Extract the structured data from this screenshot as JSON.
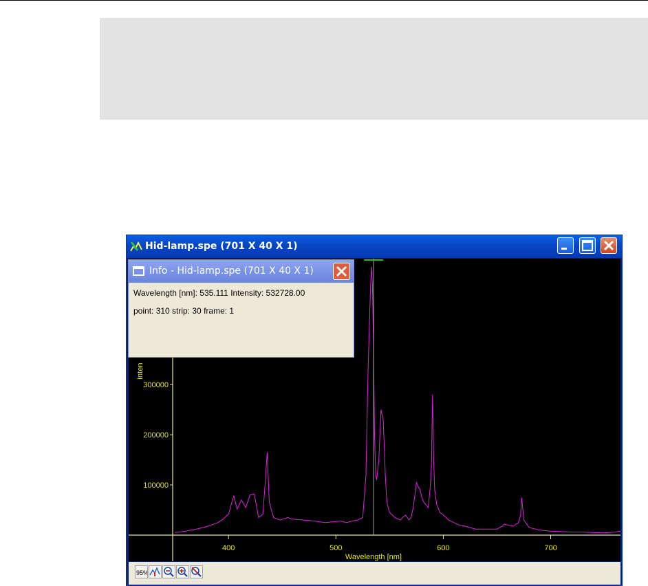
{
  "window": {
    "title": "Hid-lamp.spe (701 X 40 X 1)",
    "icons": [
      "spectrum-app-icon",
      "minimize-icon",
      "maximize-icon",
      "close-icon"
    ]
  },
  "info_panel": {
    "title": "Info - Hid-lamp.spe (701 X 40 X 1)",
    "line1": "Wavelength [nm]: 535.111   Intensity: 532728.00",
    "line2": "point: 310  strip: 30  frame: 1"
  },
  "toolbar": {
    "icons": [
      "scale-percent-icon",
      "peak-marker-icon",
      "zoom-out-icon",
      "zoom-in-icon",
      "zoom-reset-icon"
    ]
  },
  "chart_data": {
    "type": "line",
    "xlabel": "Wavelength [nm]",
    "ylabel": "Inten",
    "x_ticks": [
      400,
      500,
      600,
      700
    ],
    "y_ticks": [
      100000,
      200000,
      300000
    ],
    "y_tick_labels": [
      "100000",
      "200000",
      "300000"
    ],
    "xlim": [
      348,
      765
    ],
    "ylim": [
      0,
      540000
    ],
    "colors": {
      "trace": "#e020e0",
      "axes": "#e8e8a0",
      "labels": "#e6e600",
      "background": "#000000"
    },
    "cursor_x": 535.1,
    "series": [
      {
        "x": [
          350,
          360,
          370,
          380,
          390,
          395,
          400,
          403,
          405,
          408,
          412,
          416,
          420,
          424,
          428,
          432,
          434,
          436,
          438,
          442,
          448,
          455,
          460,
          470,
          480,
          490,
          500,
          505,
          510,
          515,
          520,
          525,
          528,
          530,
          532,
          533,
          534,
          535,
          536,
          537,
          538,
          540,
          542,
          544,
          545,
          546,
          547,
          548,
          550,
          555,
          560,
          562,
          565,
          568,
          570,
          572,
          575,
          577,
          578,
          580,
          582,
          584,
          586,
          588,
          589,
          590,
          591,
          592,
          594,
          597,
          600,
          605,
          610,
          615,
          620,
          625,
          630,
          640,
          650,
          655,
          657,
          660,
          665,
          670,
          672,
          673,
          675,
          680,
          690,
          700,
          710,
          720,
          730,
          740,
          750,
          760,
          765
        ],
        "y": [
          5000,
          8000,
          12000,
          17000,
          25000,
          32000,
          42000,
          65000,
          78000,
          52000,
          70000,
          55000,
          80000,
          82000,
          35000,
          42000,
          100000,
          165000,
          65000,
          35000,
          30000,
          35000,
          32000,
          30000,
          28000,
          25000,
          27000,
          28000,
          25000,
          28000,
          30000,
          35000,
          120000,
          330000,
          480000,
          535000,
          500000,
          380000,
          200000,
          120000,
          110000,
          150000,
          250000,
          230000,
          180000,
          120000,
          80000,
          60000,
          45000,
          35000,
          30000,
          35000,
          40000,
          30000,
          35000,
          55000,
          105000,
          95000,
          92000,
          75000,
          65000,
          60000,
          55000,
          100000,
          140000,
          280000,
          150000,
          90000,
          60000,
          45000,
          40000,
          30000,
          25000,
          20000,
          18000,
          15000,
          12000,
          12000,
          12000,
          18000,
          22000,
          20000,
          18000,
          25000,
          40000,
          75000,
          30000,
          15000,
          10000,
          8000,
          7000,
          6000,
          6000,
          5000,
          4500,
          6000,
          8000
        ]
      }
    ]
  }
}
